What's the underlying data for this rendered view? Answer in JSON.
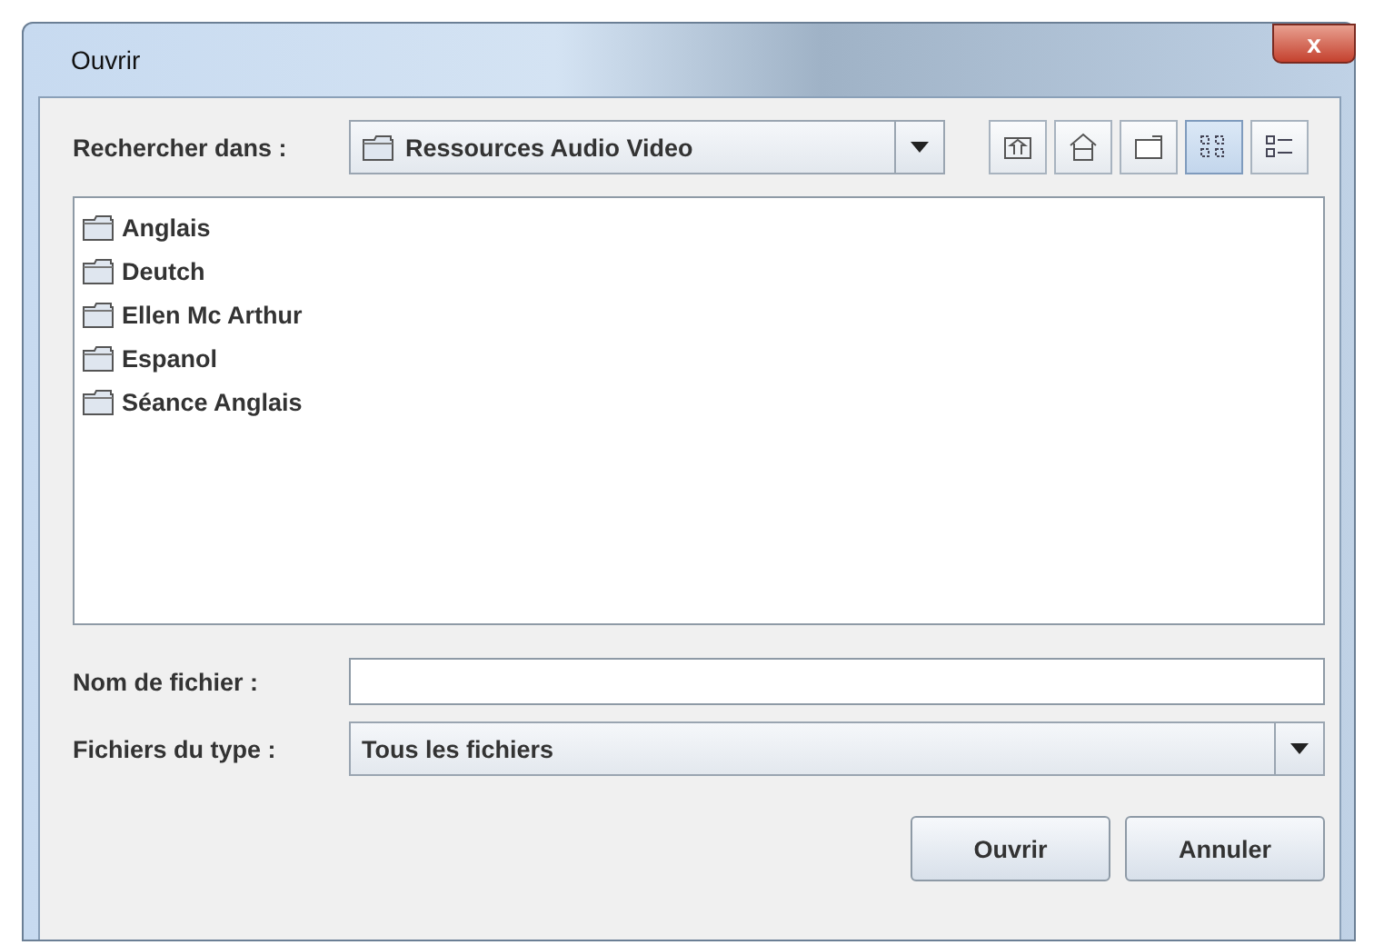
{
  "window": {
    "title": "Ouvrir",
    "close": "x"
  },
  "look_in": {
    "label": "Rechercher dans :",
    "value": "Ressources Audio Video"
  },
  "toolbar": [
    {
      "kind": "up",
      "selected": false
    },
    {
      "kind": "home",
      "selected": false
    },
    {
      "kind": "newfolder",
      "selected": false
    },
    {
      "kind": "list",
      "selected": true
    },
    {
      "kind": "details",
      "selected": false
    }
  ],
  "files": [
    {
      "name": "Anglais"
    },
    {
      "name": "Deutch"
    },
    {
      "name": "Ellen Mc Arthur"
    },
    {
      "name": "Espanol"
    },
    {
      "name": "Séance Anglais"
    }
  ],
  "file_name": {
    "label": "Nom de fichier :"
  },
  "file_type": {
    "label": "Fichiers du type :",
    "value": "Tous les fichiers"
  },
  "buttons": [
    "Ouvrir",
    "Annuler"
  ]
}
